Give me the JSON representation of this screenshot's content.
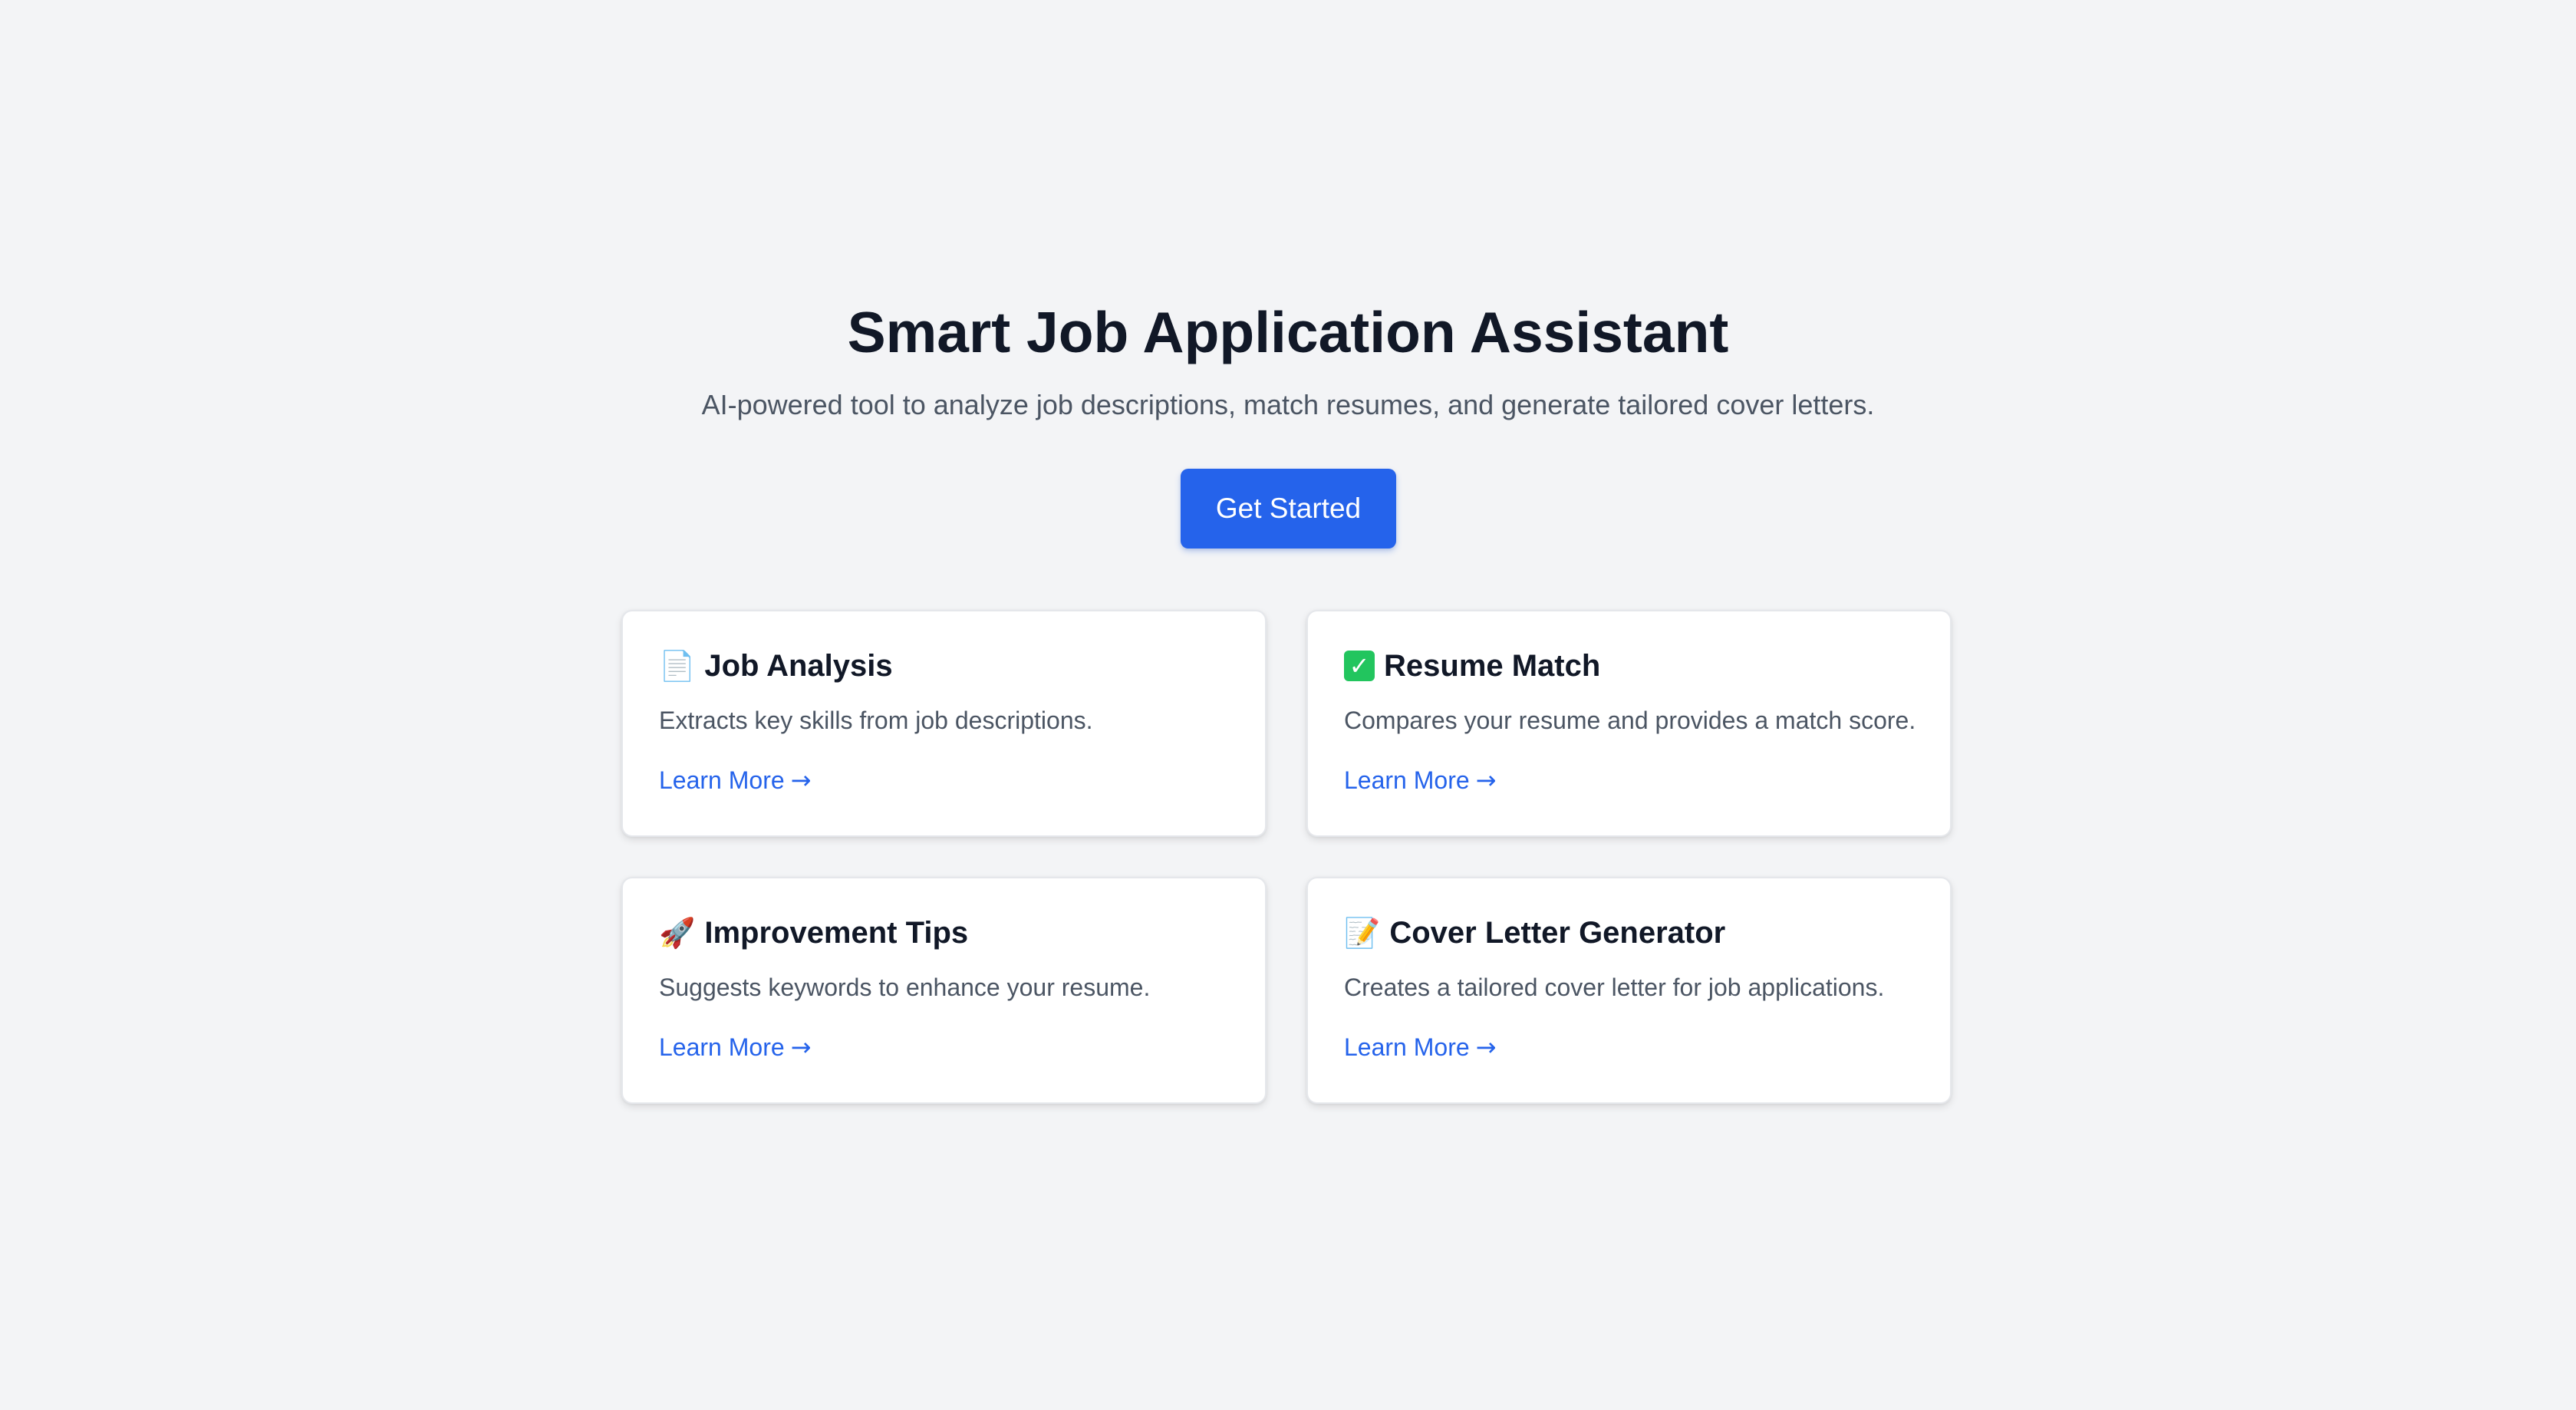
{
  "hero": {
    "title": "Smart Job Application Assistant",
    "subtitle": "AI-powered tool to analyze job descriptions, match resumes, and generate tailored cover letters.",
    "cta_label": "Get Started"
  },
  "colors": {
    "background": "#f3f4f6",
    "accent": "#2563eb",
    "heading": "#111827",
    "body_text": "#4b5563",
    "card_background": "#ffffff"
  },
  "cards": [
    {
      "icon": "page-icon",
      "emoji": "📄",
      "title": "Job Analysis",
      "description": "Extracts key skills from job descriptions.",
      "link_label": "Learn More",
      "link_arrow": "→"
    },
    {
      "icon": "check-mark-icon",
      "emoji": "✓",
      "title": "Resume Match",
      "description": "Compares your resume and provides a match score.",
      "link_label": "Learn More",
      "link_arrow": "→"
    },
    {
      "icon": "rocket-icon",
      "emoji": "🚀",
      "title": "Improvement Tips",
      "description": "Suggests keywords to enhance your resume.",
      "link_label": "Learn More",
      "link_arrow": "→"
    },
    {
      "icon": "memo-icon",
      "emoji": "📝",
      "title": "Cover Letter Generator",
      "description": "Creates a tailored cover letter for job applications.",
      "link_label": "Learn More",
      "link_arrow": "→"
    }
  ]
}
